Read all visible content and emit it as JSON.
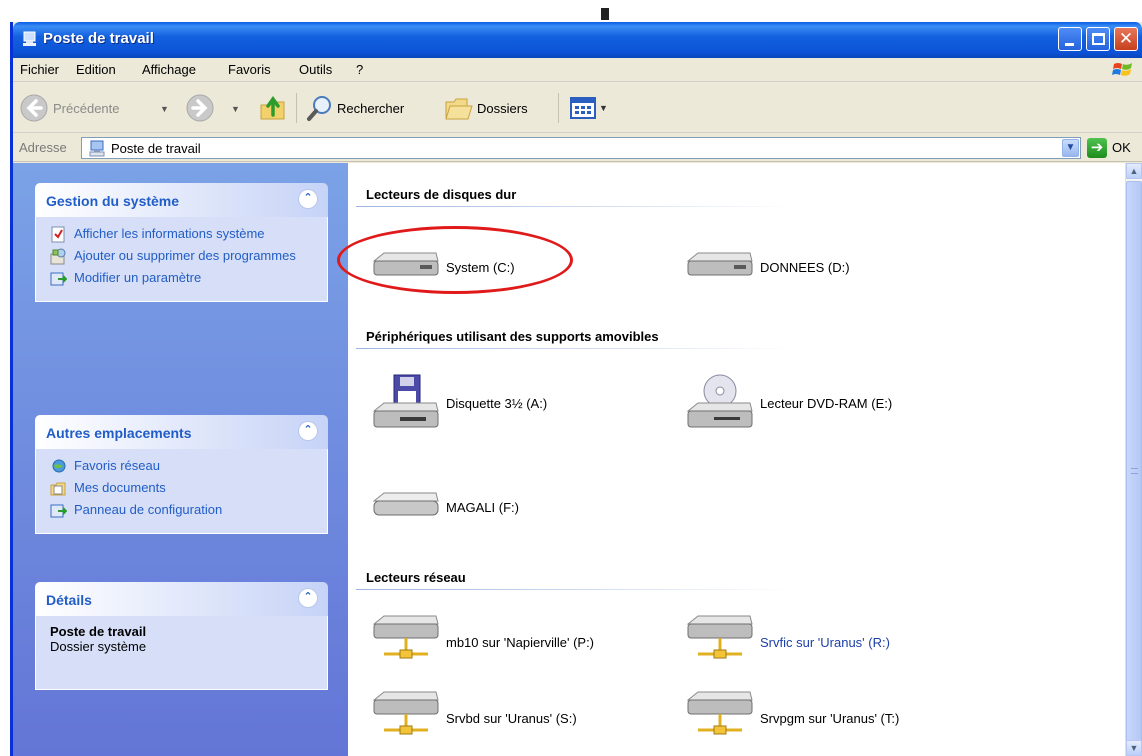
{
  "window": {
    "title": "Poste de travail"
  },
  "menu": [
    "Fichier",
    "Edition",
    "Affichage",
    "Favoris",
    "Outils",
    "?"
  ],
  "toolbar": {
    "back_label": "Précédente",
    "search_label": "Rechercher",
    "folders_label": "Dossiers"
  },
  "address": {
    "label": "Adresse",
    "value": "Poste de travail",
    "go_label": "OK"
  },
  "taskpane": {
    "system": {
      "title": "Gestion du système",
      "items": [
        "Afficher les informations système",
        "Ajouter ou supprimer des programmes",
        "Modifier un paramètre"
      ]
    },
    "places": {
      "title": "Autres emplacements",
      "items": [
        "Favoris réseau",
        "Mes documents",
        "Panneau de configuration"
      ]
    },
    "details": {
      "title": "Détails",
      "name": "Poste de travail",
      "type": "Dossier système"
    }
  },
  "sections": {
    "hard_drives": {
      "title": "Lecteurs de disques dur",
      "items": [
        "System (C:)",
        "DONNEES (D:)"
      ]
    },
    "removable": {
      "title": "Périphériques utilisant des supports amovibles",
      "items": [
        "Disquette 3½ (A:)",
        "Lecteur DVD-RAM (E:)",
        "MAGALI (F:)"
      ]
    },
    "network": {
      "title": "Lecteurs réseau",
      "items": [
        "mb10 sur 'Napierville' (P:)",
        "Srvfic sur 'Uranus' (R:)",
        "Srvbd sur 'Uranus' (S:)",
        "Srvpgm sur 'Uranus' (T:)"
      ]
    }
  },
  "colors": {
    "title_bar": "#0b52d6",
    "task_link": "#215dc6",
    "highlight": "#e01a1a"
  }
}
